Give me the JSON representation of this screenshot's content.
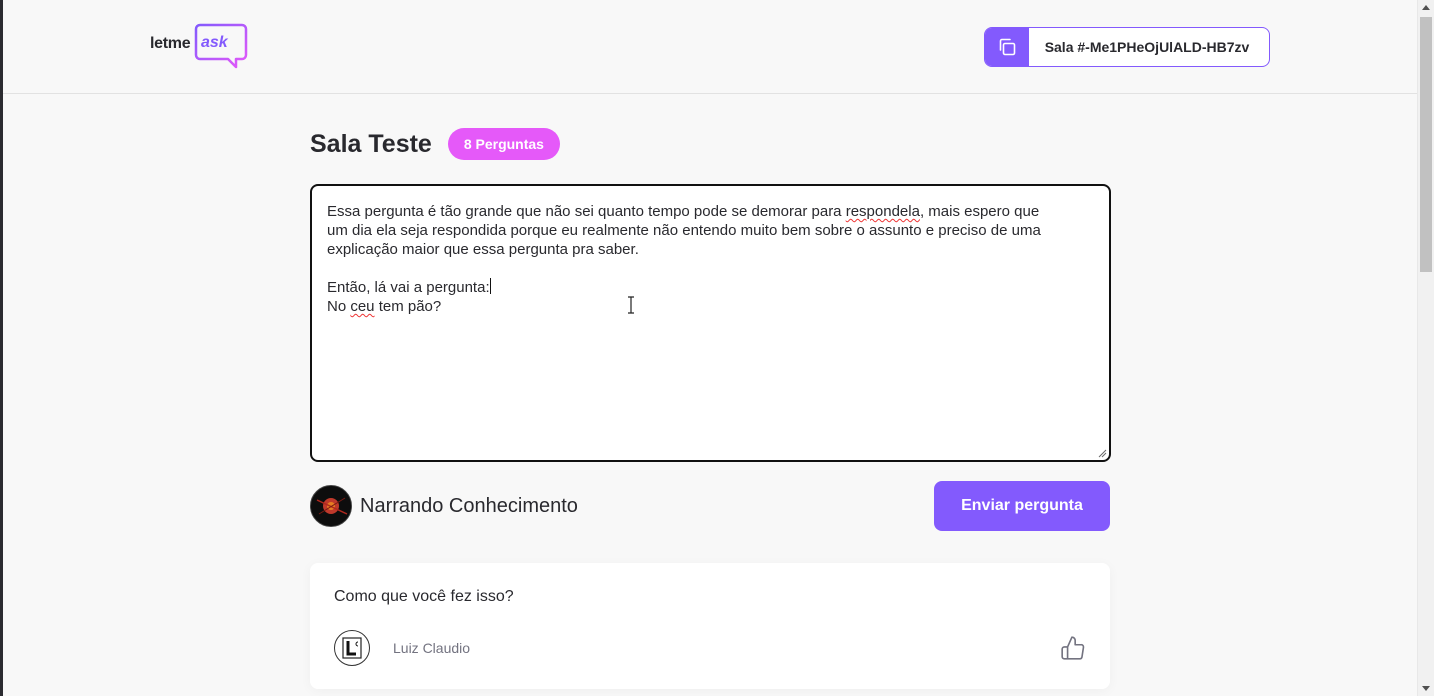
{
  "header": {
    "logo": {
      "word1": "letme",
      "word2": "ask"
    },
    "room_code": {
      "label": "Sala #-Me1PHeOjUlALD-HB7zv",
      "icon": "copy-icon"
    }
  },
  "room": {
    "title": "Sala Teste",
    "badge": "8 Perguntas"
  },
  "form": {
    "textarea_lines": [
      [
        "Essa pergunta é tão grande que não sei quanto tempo pode se demorar para ",
        "respondela",
        ", mais espero que"
      ],
      [
        "um dia ela seja respondida porque eu realmente não entendo muito bem sobre o assunto e preciso de uma"
      ],
      [
        "explicação maior que essa pergunta pra saber."
      ],
      [
        ""
      ],
      [
        "Então, lá vai a pergunta:"
      ],
      [
        "No ",
        "ceu",
        " tem pão?"
      ]
    ],
    "user_name": "Narrando Conhecimento",
    "submit_label": "Enviar pergunta"
  },
  "questions": [
    {
      "content": "Como que você fez isso?",
      "author": "Luiz Claudio",
      "like_icon": "thumbs-up-icon"
    }
  ],
  "colors": {
    "accent": "#835afd",
    "badge": "#e559f9",
    "background": "#f8f8f8",
    "text": "#29292e"
  }
}
